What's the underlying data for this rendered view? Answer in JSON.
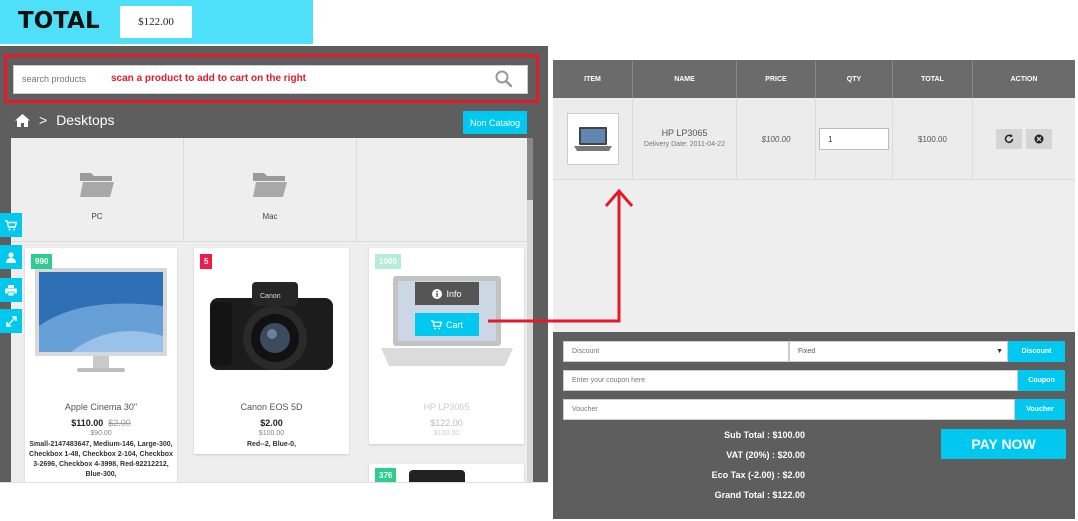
{
  "header": {
    "total_label": "TOTAL",
    "total_value": "$122.00"
  },
  "search": {
    "placeholder": "search products",
    "hint": "scan a product to add to cart on the right"
  },
  "breadcrumb": {
    "current": "Desktops"
  },
  "non_catalog_label": "Non Catalog",
  "categories": [
    {
      "label": "PC",
      "icon": "folder-icon"
    },
    {
      "label": "Mac",
      "icon": "folder-icon"
    }
  ],
  "products": [
    {
      "badge": "990",
      "badge_color": "#2ecc8f",
      "name": "Apple Cinema 30\"",
      "price": "$110.00",
      "old_price": "$2.00",
      "sub_price": "$90.00",
      "options": "Small-2147483647, Medium-146, Large-300, Checkbox 1-48, Checkbox 2-104, Checkbox 3-2696, Checkbox 4-3998, Red-92212212, Blue-300,"
    },
    {
      "badge": "5",
      "badge_color": "#ee1c4b",
      "name": "Canon EOS 5D",
      "price": "$2.00",
      "sub_price": "$100.00",
      "options": "Red--2, Blue-0,"
    },
    {
      "badge": "1000",
      "badge_color": "#2ecc8f",
      "name": "HP LP3065",
      "price": "$122.00",
      "sub_price": "$100.00"
    },
    {
      "badge": "376",
      "badge_color": "#2ecc8f"
    }
  ],
  "overlay": {
    "info_label": "Info",
    "cart_label": "Cart"
  },
  "cart": {
    "headers": [
      "ITEM",
      "NAME",
      "PRICE",
      "QTY",
      "TOTAL",
      "ACTION"
    ],
    "rows": [
      {
        "name": "HP LP3065",
        "delivery": "Delivery Date: 2011-04-22",
        "price": "$100.00",
        "qty": "1",
        "total": "$100.00"
      }
    ]
  },
  "discount": {
    "placeholder": "Discount",
    "type": "Fixed",
    "button": "Discount"
  },
  "coupon": {
    "placeholder": "Enter your coupon here",
    "button": "Coupon"
  },
  "voucher": {
    "placeholder": "Voucher",
    "button": "Voucher"
  },
  "summary": {
    "subtotal": "Sub Total : $100.00",
    "vat": "VAT (20%) : $20.00",
    "eco": "Eco Tax (-2.00) : $2.00",
    "grand": "Grand Total : $122.00"
  },
  "pay_now": "PAY NOW",
  "colors": {
    "accent": "#00c8ef",
    "banner": "#4de0f8",
    "highlight": "#e21b2b",
    "panel": "#5e5e5e"
  }
}
